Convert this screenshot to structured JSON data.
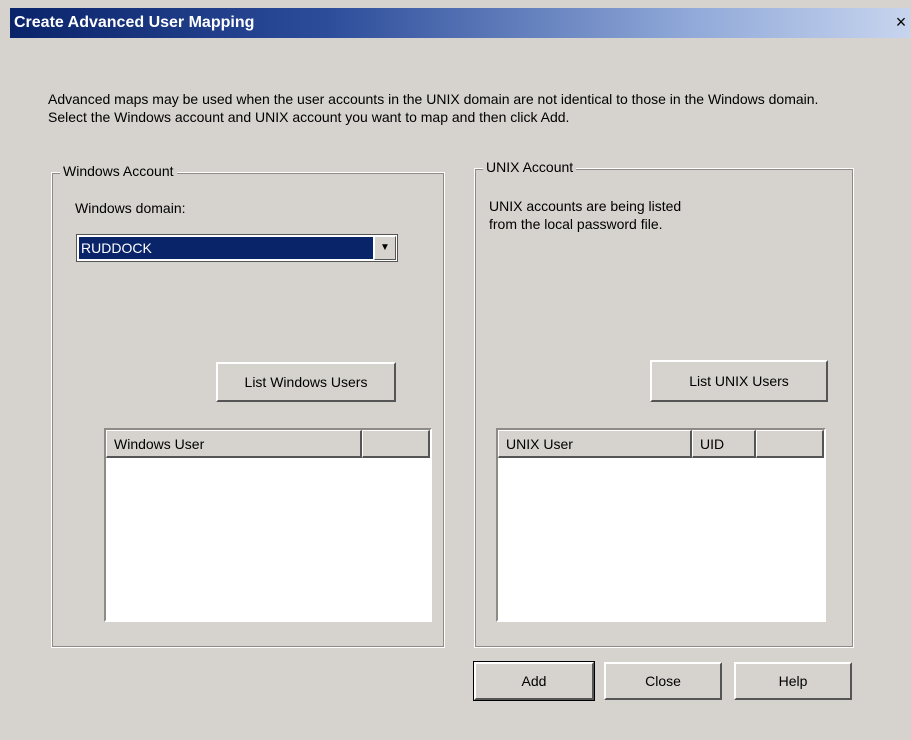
{
  "window": {
    "title": "Create Advanced User Mapping",
    "close_glyph": "×"
  },
  "description": "Advanced maps may be used when the user accounts in the UNIX domain are not identical to those in the Windows domain. Select the Windows account and UNIX account you want to map and then click Add.",
  "windows_account": {
    "group_label": "Windows Account",
    "domain_label": "Windows domain:",
    "domain_value": "RUDDOCK",
    "list_button": "List Windows Users",
    "columns": [
      "Windows User",
      ""
    ]
  },
  "unix_account": {
    "group_label": "UNIX Account",
    "info_line1": "UNIX accounts are being listed",
    "info_line2": "from the local password file.",
    "list_button": "List UNIX Users",
    "columns": [
      "UNIX User",
      "UID",
      ""
    ]
  },
  "footer": {
    "add": "Add",
    "close": "Close",
    "help": "Help"
  },
  "colors": {
    "title_bar": "#0a246a",
    "dialog_bg": "#d6d3ce",
    "selection": "#0a246a"
  }
}
